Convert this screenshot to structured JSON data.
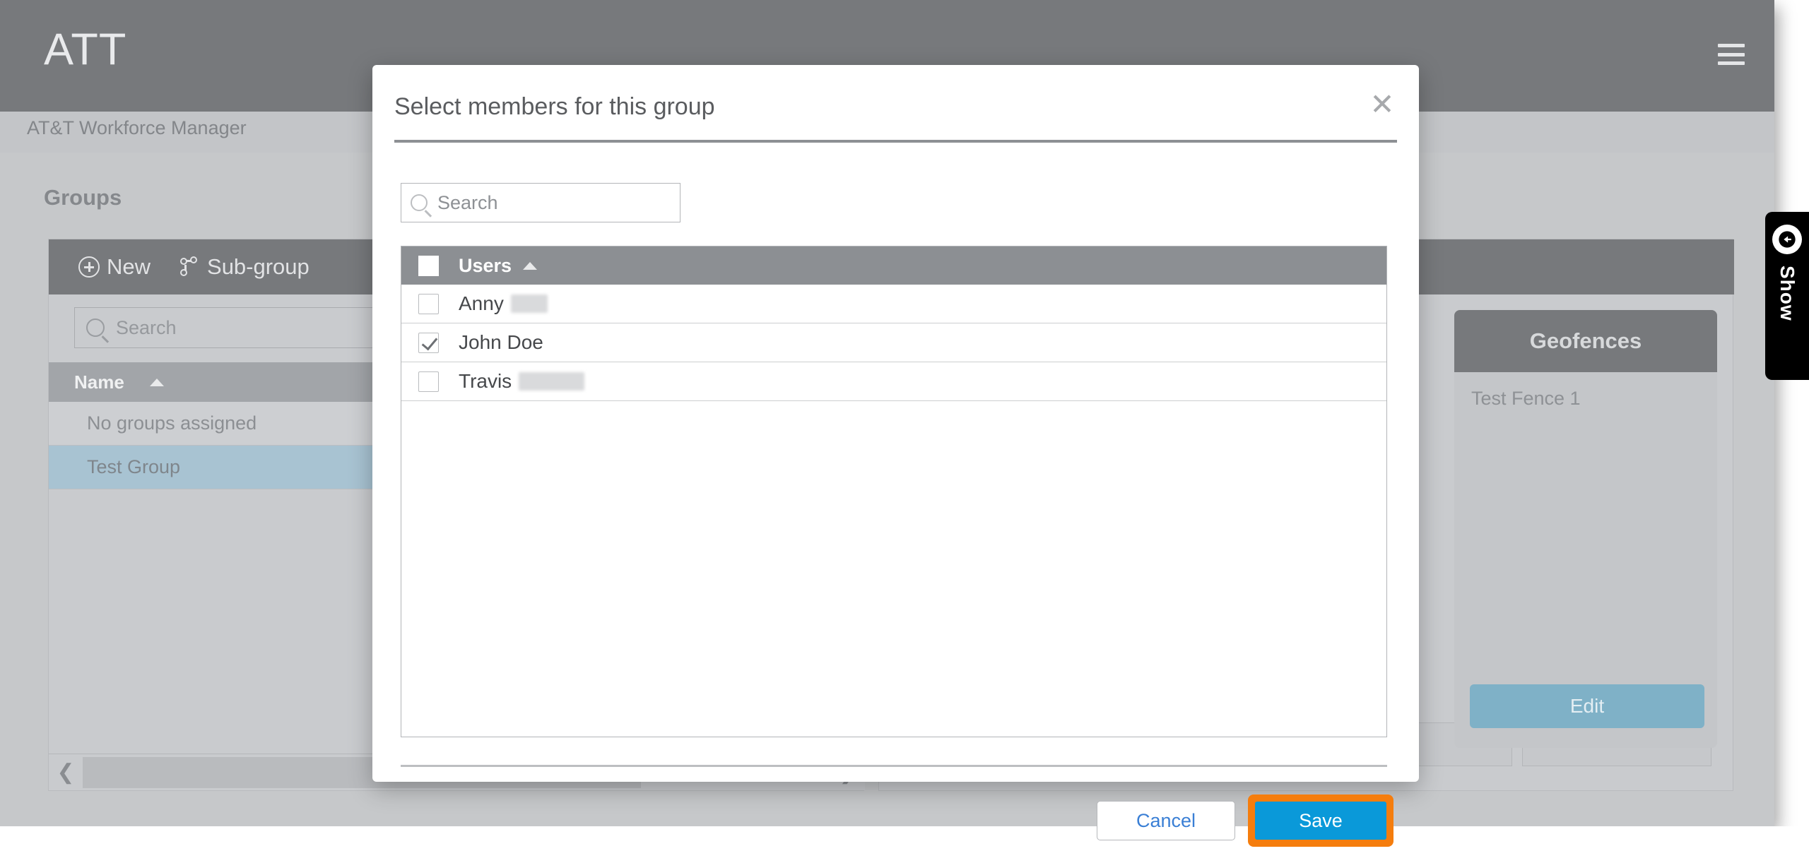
{
  "background": {
    "logo": "ATT",
    "menu_icon": "hamburger-menu-icon",
    "subtitle": "AT&T Workforce Manager",
    "page_title": "Groups",
    "groups_panel": {
      "toolbar": [
        {
          "label": "New",
          "icon": "plus-circle-icon"
        },
        {
          "label": "Sub-group",
          "icon": "sub-group-icon"
        }
      ],
      "search_placeholder": "Search",
      "column_header": "Name",
      "sort_icon": "caret-up-icon",
      "rows": [
        {
          "name": "No groups assigned",
          "selected": false,
          "has_edit": false
        },
        {
          "name": "Test Group",
          "selected": true,
          "has_edit": true
        }
      ],
      "scroll_left_icon": "chevron-left-icon",
      "scroll_right_icon": "chevron-right-icon"
    },
    "geofences_panel": {
      "title": "Geofences",
      "items": [
        "Test Fence 1"
      ],
      "edit_label": "Edit"
    },
    "show_tab": {
      "label": "Show",
      "icon": "arrow-left-circle-icon"
    }
  },
  "modal": {
    "title": "Select members for this group",
    "close_icon": "close-icon",
    "search_placeholder": "Search",
    "search_icon": "search-icon",
    "list": {
      "header_label": "Users",
      "header_sort_icon": "caret-up-icon",
      "header_checked": false,
      "rows": [
        {
          "name": "Anny",
          "redacted": "w1",
          "checked": false
        },
        {
          "name": "John Doe",
          "redacted": "",
          "checked": true
        },
        {
          "name": "Travis",
          "redacted": "w2",
          "checked": false
        }
      ]
    },
    "cancel_label": "Cancel",
    "save_label": "Save"
  },
  "colors": {
    "accent_blue": "#0a99d9",
    "highlight_orange": "#f57d0d",
    "link_blue": "#3a7fd5",
    "header_gray": "#77797c",
    "selected_row_blue": "#a8c3d2",
    "edit_button_blue": "#7fb1c7"
  }
}
